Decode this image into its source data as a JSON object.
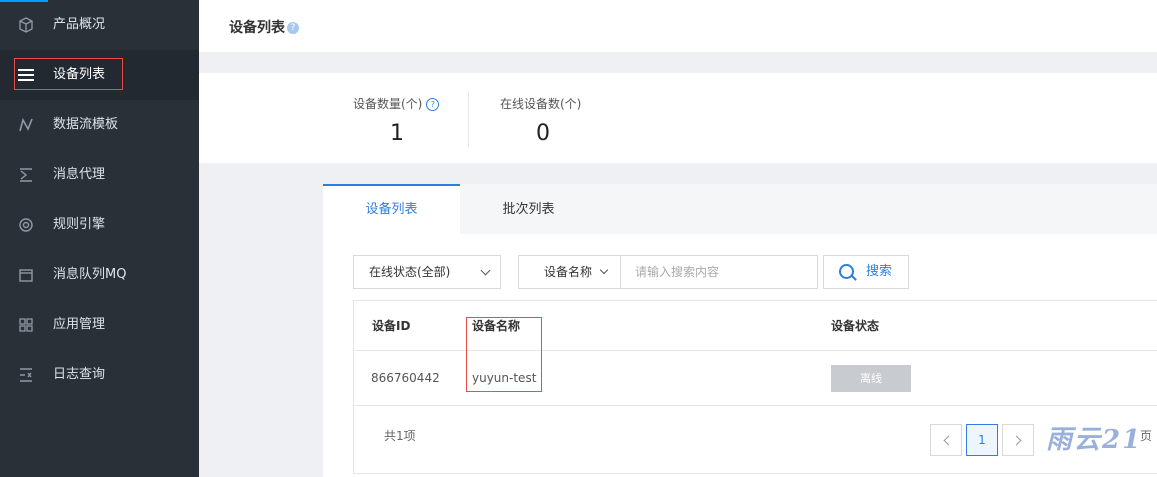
{
  "sidebar": {
    "items": [
      {
        "label": "产品概况",
        "icon": "cube-icon"
      },
      {
        "label": "设备列表",
        "icon": "menu-icon",
        "active": true
      },
      {
        "label": "数据流模板",
        "icon": "data-flow-icon"
      },
      {
        "label": "消息代理",
        "icon": "message-proxy-icon"
      },
      {
        "label": "规则引擎",
        "icon": "rule-engine-icon"
      },
      {
        "label": "消息队列MQ",
        "icon": "queue-icon"
      },
      {
        "label": "应用管理",
        "icon": "grid-icon"
      },
      {
        "label": "日志查询",
        "icon": "log-icon"
      }
    ]
  },
  "header": {
    "title": "设备列表"
  },
  "stats": {
    "device_count_label": "设备数量(个)",
    "device_count": "1",
    "online_count_label": "在线设备数(个)",
    "online_count": "0"
  },
  "tabs": [
    {
      "label": "设备列表",
      "active": true
    },
    {
      "label": "批次列表"
    }
  ],
  "filters": {
    "status_select": "在线状态(全部)",
    "field_select": "设备名称",
    "search_placeholder": "请输入搜索内容",
    "search_button": "搜索"
  },
  "table": {
    "columns": [
      "设备ID",
      "设备名称",
      "设备状态"
    ],
    "rows": [
      {
        "id": "866760442",
        "name": "yuyun-test",
        "status": "离线"
      }
    ]
  },
  "footer": {
    "total": "共1项",
    "current_page": "1",
    "page_suffix": "页"
  },
  "colors": {
    "accent": "#2d7ee0",
    "sidebar_bg": "#293038",
    "highlight_frame": "#ea4b4b"
  }
}
